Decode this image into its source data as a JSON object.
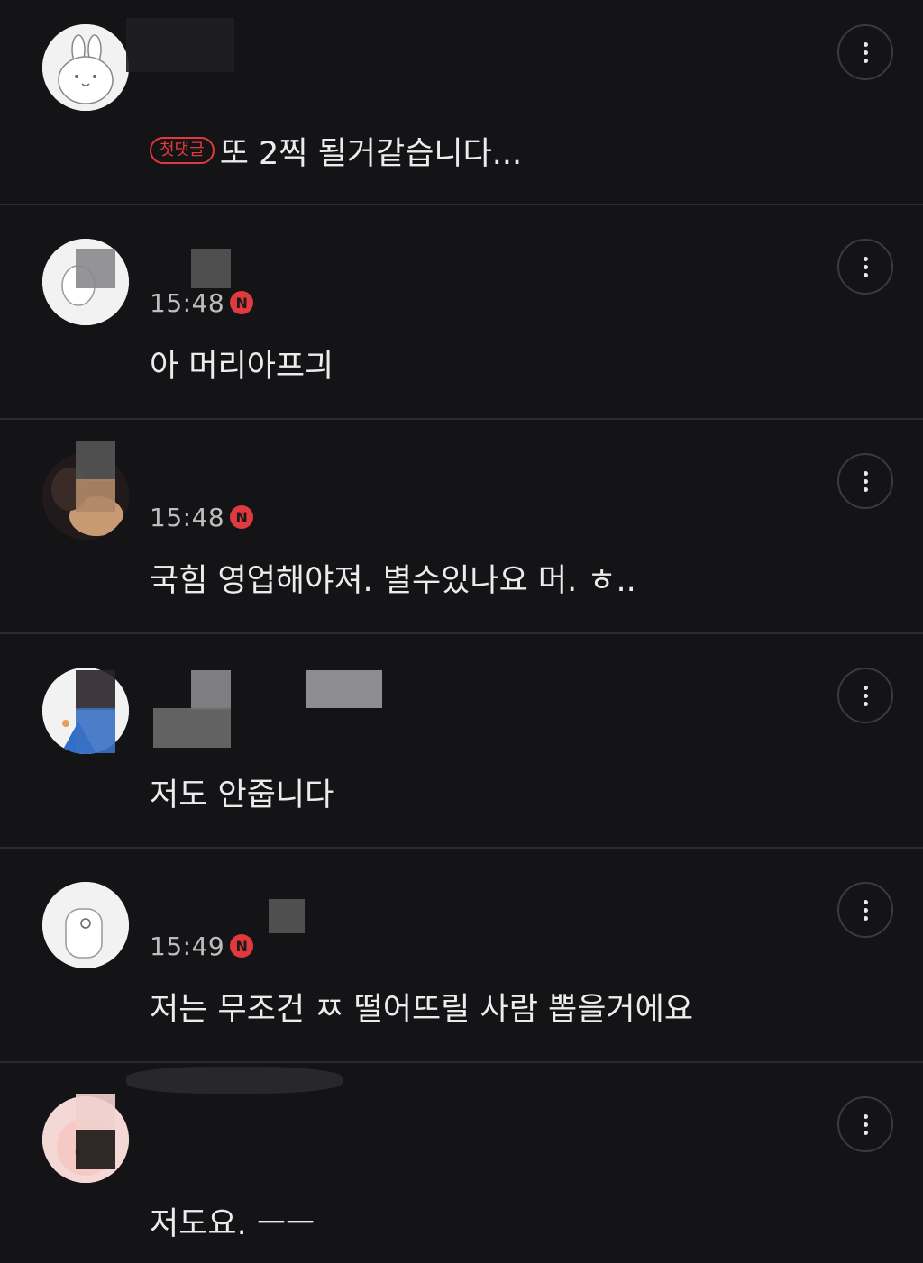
{
  "colors": {
    "background": "#141416",
    "divider": "#2a2b2f",
    "accent_red": "#e0393e",
    "text": "#ececec",
    "muted_text": "#bdbdbd"
  },
  "comments": [
    {
      "time": "",
      "new_badge": "",
      "first_comment_badge": "첫댓글",
      "text": "또 2찍 될거같습니다...",
      "menu_icon": "more-vertical-icon"
    },
    {
      "time": "15:48",
      "new_badge": "N",
      "text": "아 머리아프긔",
      "menu_icon": "more-vertical-icon"
    },
    {
      "time": "15:48",
      "new_badge": "N",
      "text": "국힘 영업해야져. 별수있나요 머. ㅎ..",
      "menu_icon": "more-vertical-icon"
    },
    {
      "time": "",
      "new_badge": "",
      "text": "저도 안줍니다",
      "menu_icon": "more-vertical-icon"
    },
    {
      "time": "15:49",
      "new_badge": "N",
      "text": "저는 무조건 ㅉ 떨어뜨릴 사람 뽑을거에요",
      "menu_icon": "more-vertical-icon"
    },
    {
      "time": "",
      "new_badge": "",
      "text": "저도요. ㅡㅡ",
      "menu_icon": "more-vertical-icon"
    }
  ]
}
